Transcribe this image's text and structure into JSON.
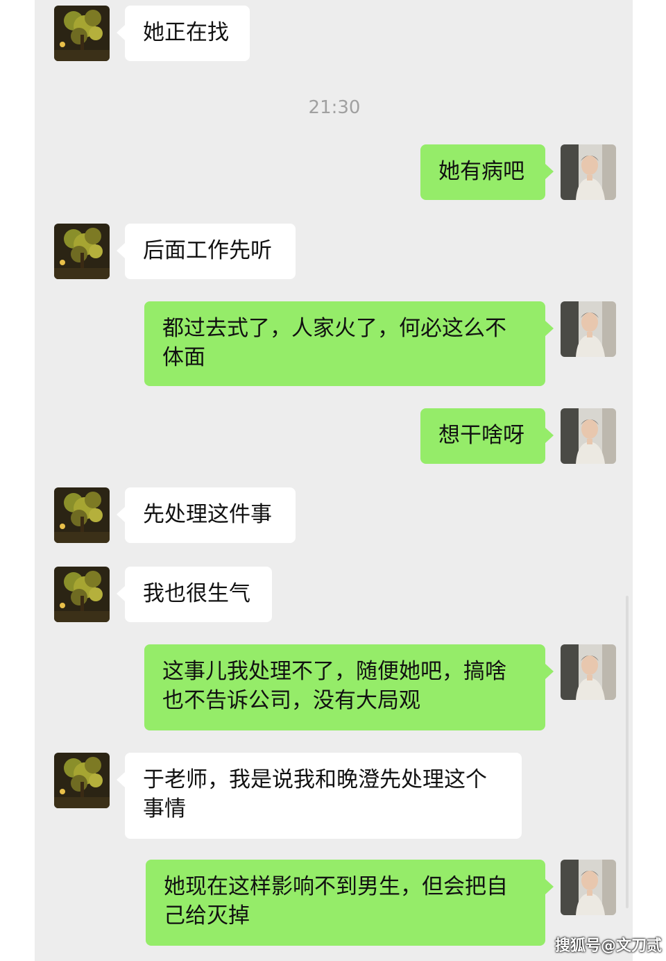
{
  "chat": {
    "timestamp": "21:30",
    "messages": [
      {
        "side": "in",
        "text": "她正在找"
      },
      {
        "side": "out",
        "text": "她有病吧"
      },
      {
        "side": "in",
        "text": "后面工作先听"
      },
      {
        "side": "out",
        "text": "都过去式了，人家火了，何必这么不体面"
      },
      {
        "side": "out",
        "text": "想干啥呀"
      },
      {
        "side": "in",
        "text": "先处理这件事"
      },
      {
        "side": "in",
        "text": "我也很生气"
      },
      {
        "side": "out",
        "text": "这事儿我处理不了，随便她吧，搞啥也不告诉公司，没有大局观"
      },
      {
        "side": "in",
        "text": "于老师，我是说我和晚澄先处理这个事情"
      },
      {
        "side": "out",
        "text": "她现在这样影响不到男生，但会把自己给灭掉"
      }
    ]
  },
  "watermark": "搜狐号@文刀贰",
  "colors": {
    "chat_background": "#ededed",
    "incoming_bubble": "#ffffff",
    "outgoing_bubble": "#95ec69",
    "timestamp_text": "#a0a0a0"
  },
  "icons": {
    "contact_avatar": "night-tree-photo-avatar",
    "self_avatar": "man-portrait-avatar"
  }
}
